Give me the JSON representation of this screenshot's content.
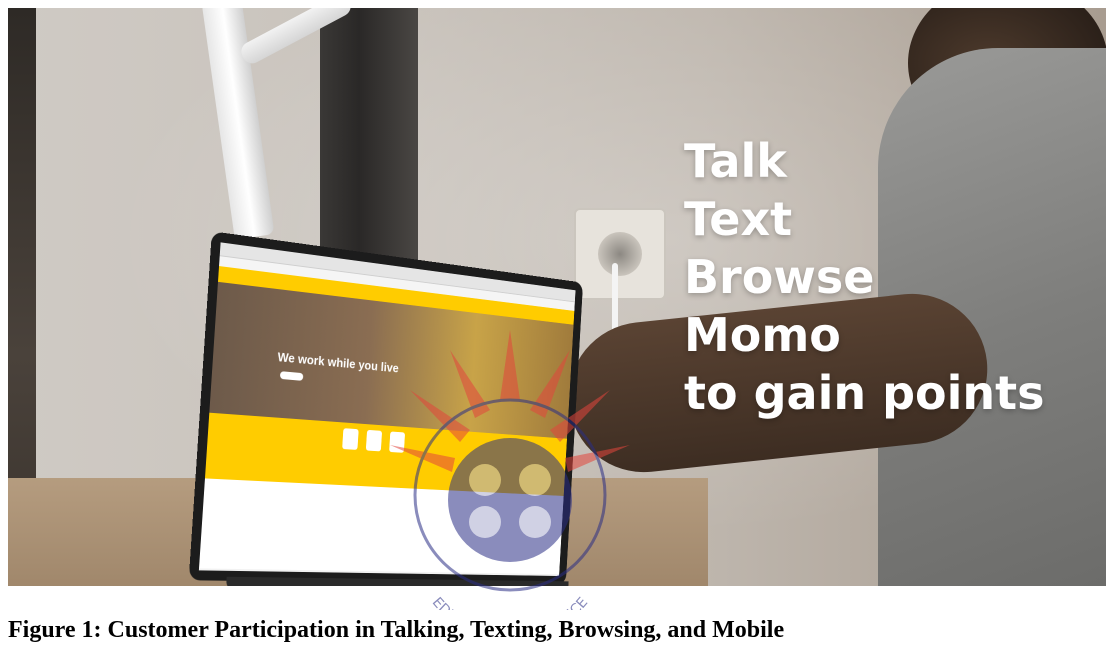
{
  "figure": {
    "overlay_lines": [
      "Talk",
      "Text",
      "Browse",
      "Momo",
      "to gain points"
    ],
    "laptop_hero_text": "We work while you live",
    "caption": "Figure 1: Customer Participation in Talking, Texting, Browsing, and Mobile",
    "colors": {
      "brand_yellow": "#ffcc00",
      "overlay_text": "#ffffff",
      "watermark_red": "#e2453c",
      "watermark_blue": "#2b2f86"
    },
    "watermark": {
      "motto_arc": "EDUCATION FOR SERVICE"
    }
  }
}
